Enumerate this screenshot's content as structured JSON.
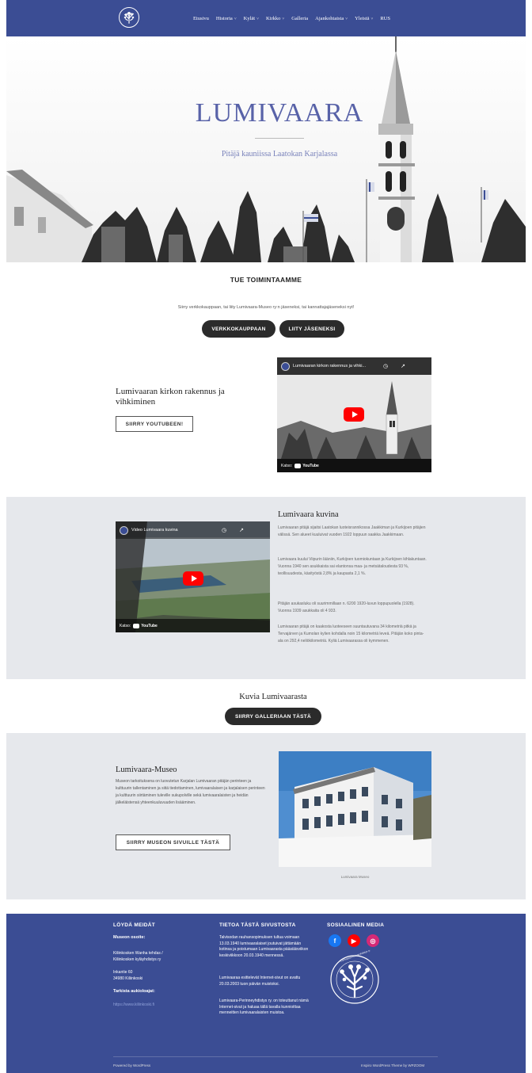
{
  "nav": {
    "items": [
      {
        "label": "Etusivu",
        "caret": false
      },
      {
        "label": "Historia",
        "caret": true
      },
      {
        "label": "Kylät",
        "caret": true
      },
      {
        "label": "Kirkko",
        "caret": true
      },
      {
        "label": "Galleria",
        "caret": false
      },
      {
        "label": "Ajankohtaista",
        "caret": true
      },
      {
        "label": "Yleistä",
        "caret": true
      },
      {
        "label": "RUS",
        "caret": false
      }
    ]
  },
  "hero": {
    "title": "LUMIVAARA",
    "subtitle": "Pitäjä kauniissa Laatokan Karjalassa"
  },
  "support": {
    "title": "TUE TOIMINTAAMME",
    "text": "Siirry verkkokauppaan, tai liity Lumivaara-Museo ry:n jäseneksi, tai kannattajajäseneksi nyt!",
    "btn_shop": "VERKKOKAUPPAAN",
    "btn_join": "LIITY JÄSENEKSI"
  },
  "church_video": {
    "heading": "Lumivaaran kirkon rakennus ja vihkiminen",
    "button": "SIIRRY YOUTUBEEN!",
    "video_title": "Lumivaaran kirkon rakennus ja vihki...",
    "watch_label": "Katso:",
    "yt_label": "YouTube"
  },
  "pictures_section": {
    "heading": "Lumivaara kuvina",
    "video_title": "Video Lumivaara kuvina",
    "watch_label": "Katso:",
    "yt_label": "YouTube",
    "paragraphs": [
      "Lumivaaran pitäjä sijaitsi Laatokan luoteisrannikossa Jaakkiman ja Kurkijoen pitäjien välissä. Sen alueet kuuluivat vuoden 1922 loppuun saakka Jaakkimaan.",
      "Lumivaara kuului Viipurin lääniin, Kurkijoen tuomiokuntaan ja Kurkijoen kihlakuntaan. Vuonna 1940 sen asukkaista sai elantonsa maa- ja metsätaloudesta 93 %, teollisuudesta, käsityöstä 2,8% ja kaupasta 2,1 %.",
      "Pitäjän asukasluku oli suurimmillaan n. 6200 1920-luvun loppupuolella (1928). Vuonna 1939 asukkaita oli 4 933.",
      "Lumivaaran pitäjä on kaakosta luoteeseen suuntautuvana 34 kilometriä pitkä ja Tervajärven ja Kumolan kylien kohdalla noin 15 kilometriä leveä. Pitäjän koko pinta-ala on 292,4 neliökilometriä. Kyliä Lumivaarassa oli kymmenen."
    ]
  },
  "gallery": {
    "heading": "Kuvia Lumivaarasta",
    "button": "SIIRRY GALLERIAAN TÄSTÄ"
  },
  "museum": {
    "heading": "Lumivaara-Museo",
    "text": "Museon tarkoituksena on luovutetun Karjalan Lumivaaran pitäjän perinteen ja kulttuurin tallentaminen ja siitä tiedottaminen, lumivaaralaisen ja karjalaisen perinteen ja kulttuurin siirtäminen tuleville sukupolville sekä lumivaaralaisten ja heidän jälkeläistensä yhteenkuuluvuuden lisääminen.",
    "button": "SIIRRY MUSEON SIVUILLE TÄSTÄ",
    "caption": "Lumivaara Museo"
  },
  "footer": {
    "col1_title": "LÖYDÄ MEIDÄT",
    "address_title": "Museon osoite:",
    "address_lines": [
      "Kiliinkosken Wanha tehdas /",
      "Kiliinkosken kyläyhdistys ry",
      "",
      "Inkantie 60",
      "34980 Kiliinkoski"
    ],
    "hours_title": "Tarkista aukioloajat:",
    "hours_link": "https://www.kiliinkoski.fi",
    "col2_title": "TIETOA TÄSTÄ SIVUSTOSTA",
    "col2_paragraphs": [
      "Talvisodan rauhansopimuksen tultua voimaan 13.03.1940 lumivaaralaiset joutuivat jättämään kotinsa ja poistumaan Lumivaarasta pääsiäisviikon keskiviikkoon 20.03.1940 mennessä.",
      "Lumivaaraa esittelevät Internet-sivut on avattu 20.03.2003 tuon päivän muistoksi.",
      "Lumivaara-Perinneyhdistys ry. on toteuttanut nämä Internet-sivut ja haluaa tällä tavalla kunnioittaa menneitten lumivaaralaisten muistoa."
    ],
    "col3_title": "SOSIAALINEN MEDIA",
    "emblem_text": "Lumivaara-Perinneyhdistys ry",
    "powered": "Powered by WordPress",
    "theme": "Inspiro WordPress Theme by WPZOOM"
  },
  "colors": {
    "brand": "#3b4d94",
    "hero_title": "#5862a8",
    "band": "#e6e8ec",
    "facebook": "#1877f2",
    "youtube": "#ff0000",
    "instagram": "#d62976"
  }
}
